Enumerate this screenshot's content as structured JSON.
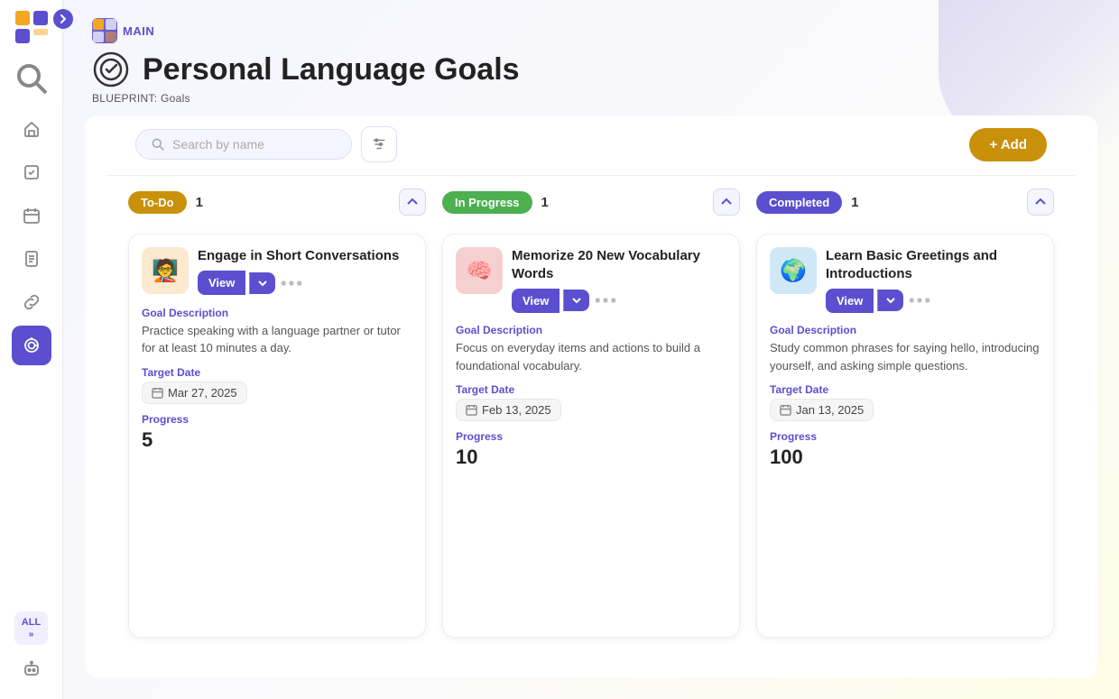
{
  "sidebar": {
    "expand_title": "Expand sidebar",
    "nav_items": [
      {
        "id": "home",
        "icon": "home-icon",
        "label": "Home",
        "active": false
      },
      {
        "id": "tasks",
        "icon": "tasks-icon",
        "label": "Tasks",
        "active": false
      },
      {
        "id": "calendar",
        "icon": "calendar-icon",
        "label": "Calendar",
        "active": false
      },
      {
        "id": "docs",
        "icon": "docs-icon",
        "label": "Documents",
        "active": false
      },
      {
        "id": "links",
        "icon": "links-icon",
        "label": "Links",
        "active": false
      },
      {
        "id": "goals",
        "icon": "goals-icon",
        "label": "Goals",
        "active": true
      }
    ],
    "all_label": "ALL",
    "bot_icon": "bot-icon"
  },
  "header": {
    "breadcrumb_app": "MAIN",
    "title": "Personal Language Goals",
    "blueprint_label": "BLUEPRINT:",
    "blueprint_value": "Goals"
  },
  "toolbar": {
    "search_placeholder": "Search by name",
    "filter_label": "Filter",
    "add_label": "+ Add"
  },
  "columns": [
    {
      "id": "todo",
      "status": "To-Do",
      "status_class": "todo",
      "count": 1,
      "cards": [
        {
          "id": "card1",
          "title": "Engage in Short Conversations",
          "img_emoji": "🧑‍🏫",
          "img_bg": "#fde8d0",
          "goal_description_label": "Goal Description",
          "goal_description": "Practice speaking with a language partner or tutor for at least 10 minutes a day.",
          "target_date_label": "Target Date",
          "target_date": "Mar 27, 2025",
          "progress_label": "Progress",
          "progress_value": "5"
        }
      ]
    },
    {
      "id": "inprogress",
      "status": "In Progress",
      "status_class": "inprogress",
      "count": 1,
      "cards": [
        {
          "id": "card2",
          "title": "Memorize 20 New Vocabulary Words",
          "img_emoji": "🧠",
          "img_bg": "#f5d0d0",
          "goal_description_label": "Goal Description",
          "goal_description": "Focus on everyday items and actions to build a foundational vocabulary.",
          "target_date_label": "Target Date",
          "target_date": "Feb 13, 2025",
          "progress_label": "Progress",
          "progress_value": "10"
        }
      ]
    },
    {
      "id": "completed",
      "status": "Completed",
      "status_class": "completed",
      "count": 1,
      "cards": [
        {
          "id": "card3",
          "title": "Learn Basic Greetings and Introductions",
          "img_emoji": "🌍",
          "img_bg": "#d0e8f5",
          "goal_description_label": "Goal Description",
          "goal_description": "Study common phrases for saying hello, introducing yourself, and asking simple questions.",
          "target_date_label": "Target Date",
          "target_date": "Jan 13, 2025",
          "progress_label": "Progress",
          "progress_value": "100"
        }
      ]
    }
  ],
  "view_btn_label": "View",
  "icons": {
    "chevron_down": "▾",
    "ellipsis": "⋯",
    "calendar": "📅"
  }
}
